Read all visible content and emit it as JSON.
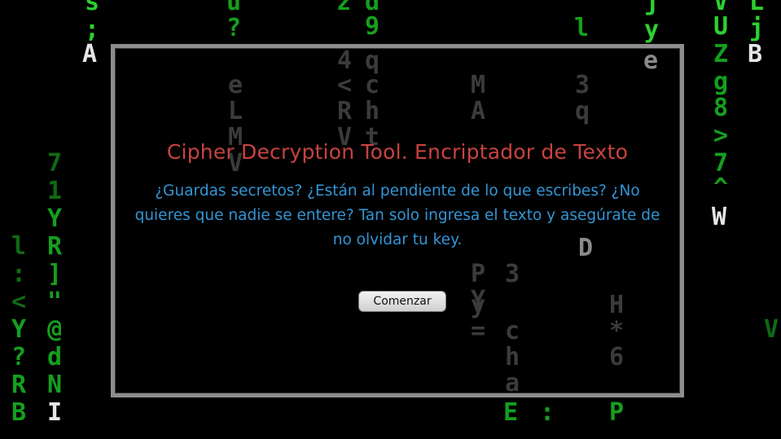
{
  "dialog": {
    "title": "Cipher Decryption Tool. Encriptador de Texto",
    "description": "¿Guardas secretos? ¿Están al pendiente de lo que escribes? ¿No quieres que nadie se entere? Tan solo ingresa el texto y asegúrate de no olvidar tu key.",
    "start_label": "Comenzar"
  },
  "background_glyphs": [
    "s",
    ";",
    "A",
    "u",
    "?",
    "z",
    "d",
    "9",
    "j",
    "y",
    "l",
    "L",
    "V",
    "U",
    "j",
    "Z",
    "B",
    "g",
    "8",
    ">",
    "7",
    "^",
    "W",
    "7",
    "1",
    "Y",
    "R",
    "]",
    "\"",
    "@",
    "d",
    "N",
    "I",
    "l",
    ":",
    "<",
    "Y",
    "?",
    "R",
    "B",
    "e",
    "L",
    "M",
    "V",
    "4",
    "q",
    "<",
    "c",
    "R",
    "h",
    "V",
    "t",
    "M",
    "A",
    "P",
    "Y",
    "E",
    "c",
    "h",
    "V",
    "a",
    "3",
    ":",
    "q",
    "3",
    "D",
    "H",
    "*",
    "6",
    "P",
    "=",
    "y",
    "e"
  ],
  "colors": {
    "background": "#000000",
    "matrix_green": "#14a01e",
    "title": "#c8433f",
    "description": "#3296d6",
    "frame": "#8d8d8d"
  }
}
